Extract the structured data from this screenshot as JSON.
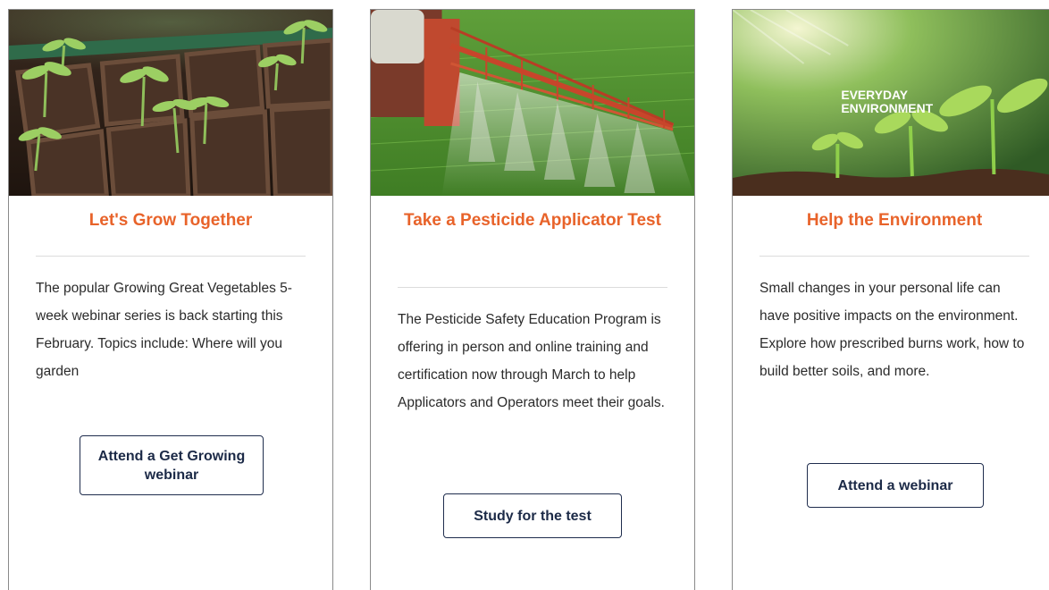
{
  "cards": [
    {
      "title": "Let's Grow Together",
      "body": "The popular Growing Great Vegetables 5-week webinar series is back starting this February. Topics include: Where will you garden",
      "button": "Attend a Get Growing webinar"
    },
    {
      "title": "Take a Pesticide Applicator Test",
      "body": "The Pesticide Safety Education Program is offering in person and online training and certification now through March to help Applicators and Operators meet their goals.",
      "button": "Study for the test"
    },
    {
      "title": "Help the Environment",
      "body": "Small changes in your personal life can have positive impacts on the environment. Explore how prescribed burns work, how to build better soils, and more.",
      "button": "Attend a webinar",
      "image_text_line1": "EVERYDAY",
      "image_text_line2": "ENVIRONMENT"
    }
  ],
  "colors": {
    "title": "#e8632a",
    "button_text": "#1c2a47",
    "button_border": "#1f2d4d",
    "card_border": "#8a8a8a"
  },
  "icons": {
    "card1_image": "seedling-tray-photo",
    "card2_image": "crop-sprayer-photo",
    "card3_image": "sprouts-photo"
  }
}
